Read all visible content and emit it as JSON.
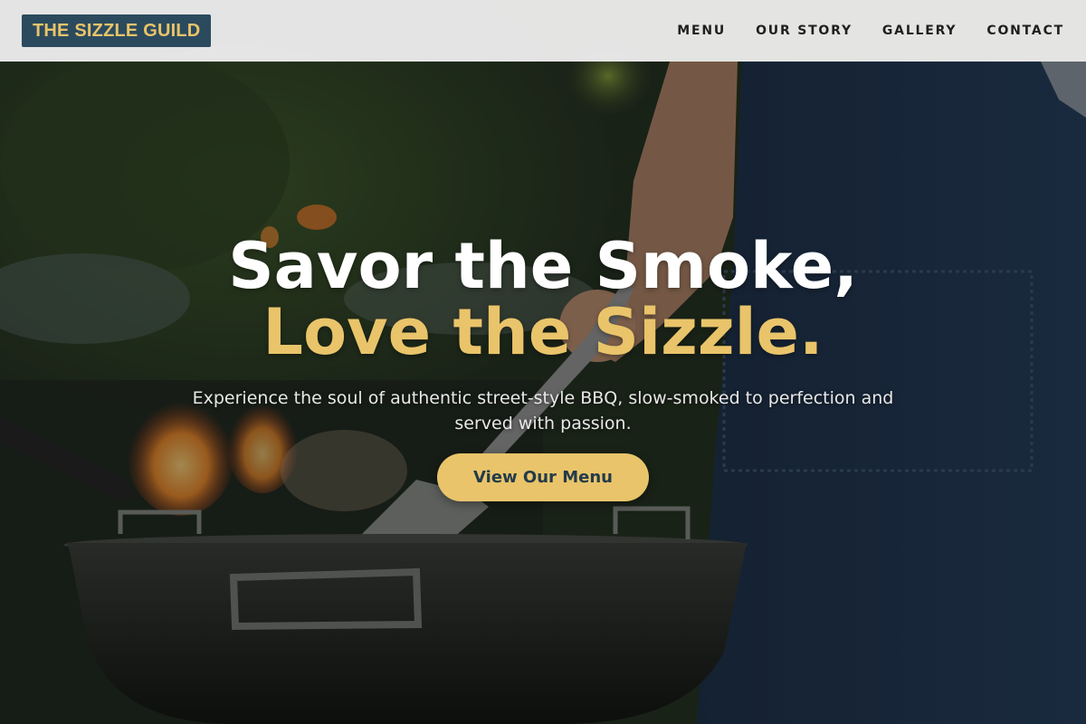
{
  "header": {
    "logo": "THE SIZZLE GUILD",
    "nav": [
      {
        "label": "MENU"
      },
      {
        "label": "OUR STORY"
      },
      {
        "label": "GALLERY"
      },
      {
        "label": "CONTACT"
      }
    ]
  },
  "hero": {
    "headline_line1": "Savor the Smoke,",
    "headline_line2": "Love the Sizzle.",
    "subtitle": "Experience the soul of authentic street-style BBQ, slow-smoked to perfection and served with passion.",
    "cta_label": "View Our Menu",
    "background": "bbq-grill-chef-photo"
  },
  "colors": {
    "accent": "#e9c46a",
    "logo_bg": "#2b4a5e",
    "nav_bg": "#ececec",
    "cta_text": "#243b4a"
  }
}
